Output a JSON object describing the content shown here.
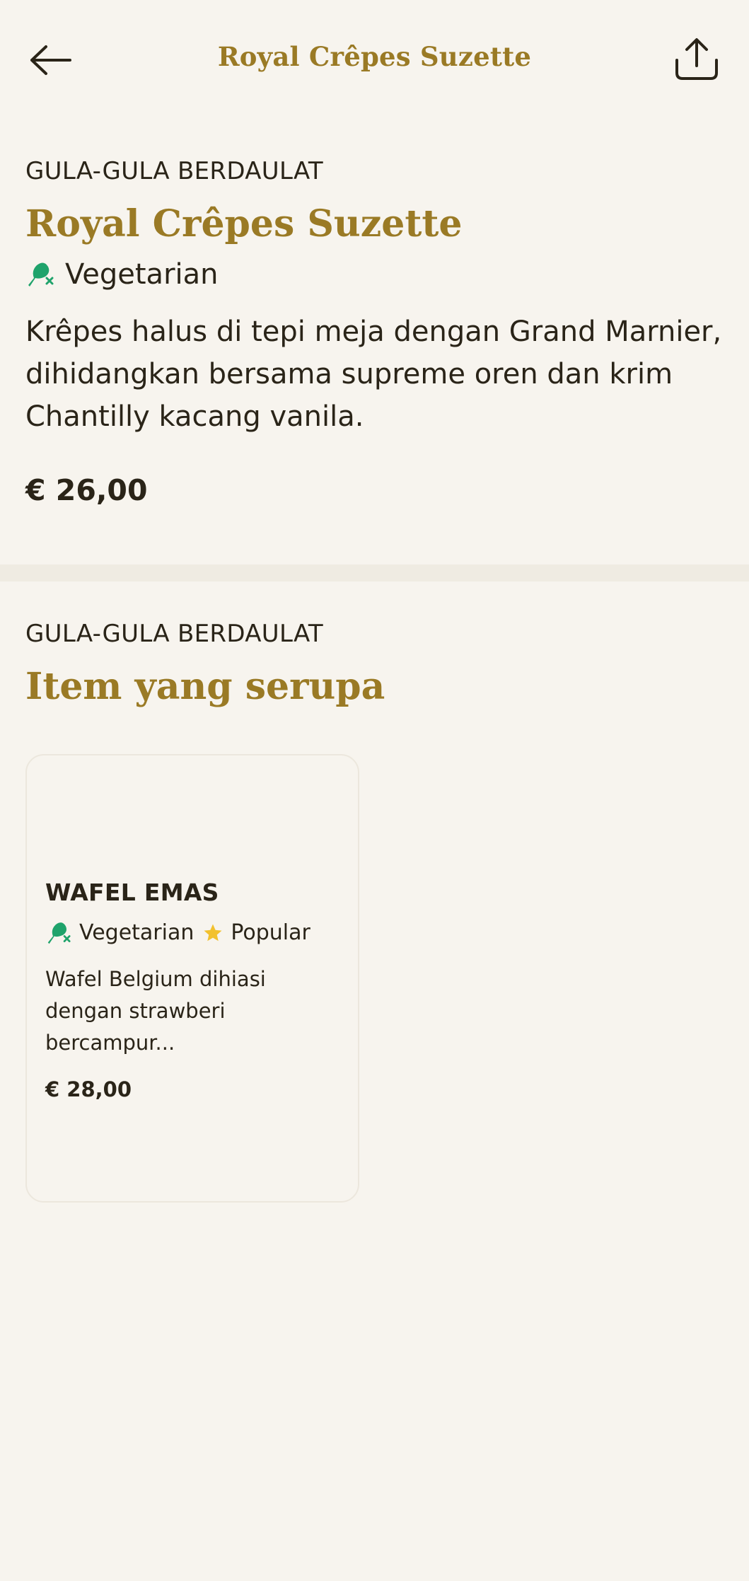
{
  "header": {
    "title": "Royal Crêpes Suzette",
    "back_icon": "arrow-left-icon",
    "share_icon": "share-upload-icon"
  },
  "item": {
    "category": "GULA-GULA BERDAULAT",
    "title": "Royal Crêpes Suzette",
    "diet_label": "Vegetarian",
    "diet_icon": "no-meat-drumstick-icon",
    "description": "Krêpes halus di tepi meja dengan Grand Marnier, dihidangkan bersama supreme oren dan krim Chantilly kacang vanila.",
    "price": "€ 26,00"
  },
  "similar": {
    "category": "GULA-GULA BERDAULAT",
    "title": "Item yang serupa",
    "cards": [
      {
        "name": "WAFEL EMAS",
        "diet_label": "Vegetarian",
        "popular_label": "Popular",
        "description": "Wafel Belgium dihiasi dengan strawberi bercampur...",
        "price": "€ 28,00"
      }
    ]
  },
  "colors": {
    "background": "#f7f4ee",
    "accent_gold": "#9a7a25",
    "text": "#2a2418",
    "vegetarian_green": "#1fa36b",
    "star_yellow": "#f2c12e"
  }
}
